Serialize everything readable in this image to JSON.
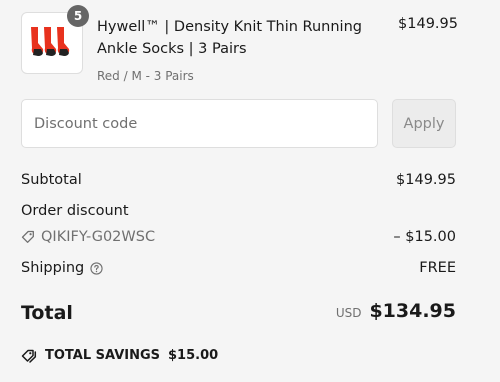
{
  "product": {
    "quantity_badge": "5",
    "name": "Hywell™ | Density Knit Thin Running Ankle Socks | 3 Pairs",
    "variant": "Red / M - 3 Pairs",
    "price": "$149.95",
    "thumbnail_icon": "socks-product-image"
  },
  "discount": {
    "placeholder": "Discount code",
    "value": "",
    "apply_label": "Apply"
  },
  "summary": {
    "subtotal_label": "Subtotal",
    "subtotal_value": "$149.95",
    "order_discount_label": "Order discount",
    "discount_code": "QIKIFY-G02WSC",
    "discount_amount": "– $15.00",
    "shipping_label": "Shipping",
    "shipping_value": "FREE",
    "total_label": "Total",
    "currency": "USD",
    "total_value": "$134.95",
    "savings_label": "TOTAL SAVINGS",
    "savings_value": "$15.00"
  },
  "colors": {
    "background": "#f5f5f5",
    "text": "#1a1a1a",
    "muted": "#707070",
    "sock_red": "#e8321e"
  }
}
